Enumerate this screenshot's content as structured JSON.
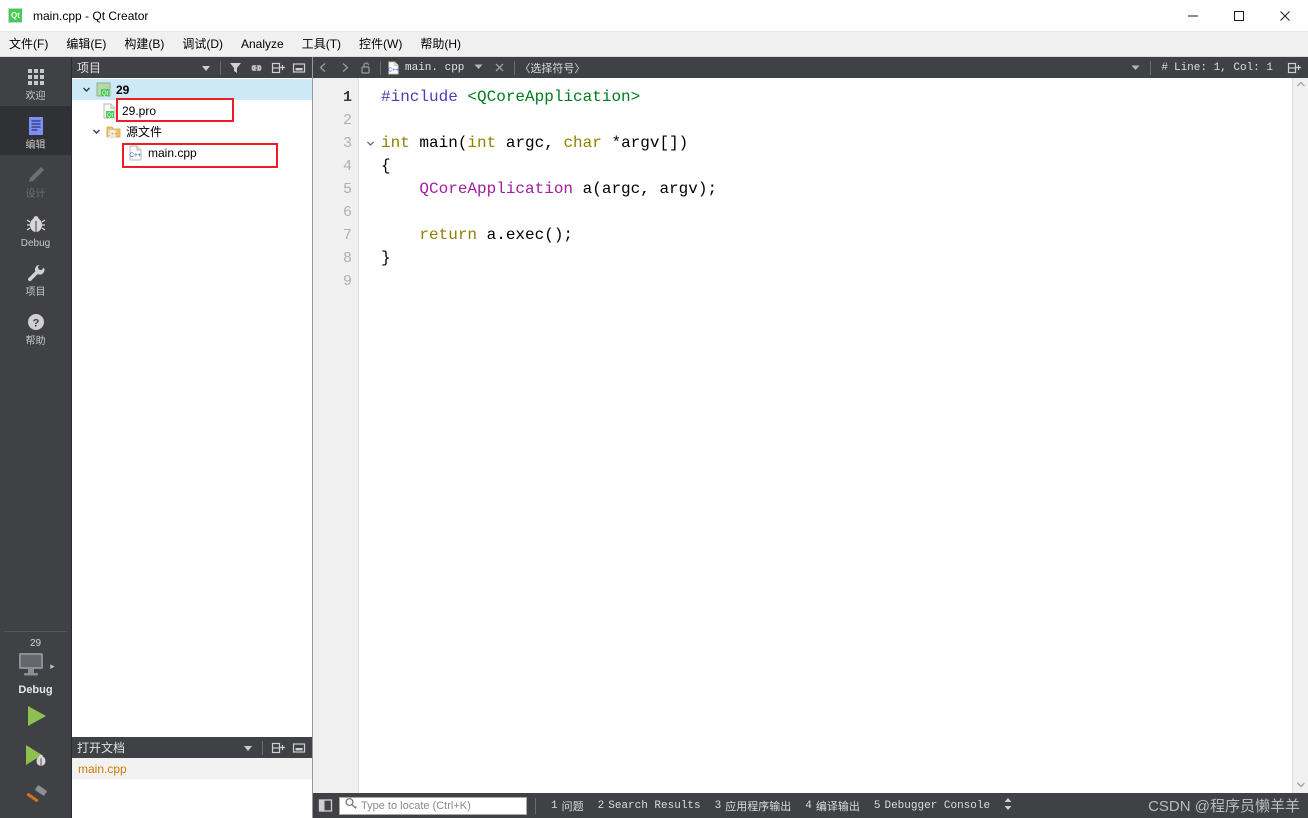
{
  "window": {
    "title": "main.cpp - Qt Creator",
    "app_icon": "qt-logo-icon",
    "logo_text": "Qt",
    "minimize_label": "—",
    "maximize_label": "□",
    "close_label": "✕"
  },
  "menubar": {
    "items": [
      {
        "label": "文件(F)"
      },
      {
        "label": "编辑(E)"
      },
      {
        "label": "构建(B)"
      },
      {
        "label": "调试(D)"
      },
      {
        "label": "Analyze"
      },
      {
        "label": "工具(T)"
      },
      {
        "label": "控件(W)"
      },
      {
        "label": "帮助(H)"
      }
    ]
  },
  "modebar": {
    "items": [
      {
        "label": "欢迎",
        "icon": "grid-icon",
        "state": "normal"
      },
      {
        "label": "编辑",
        "icon": "document-lines-icon",
        "state": "active"
      },
      {
        "label": "设计",
        "icon": "pencil-icon",
        "state": "disabled"
      },
      {
        "label": "Debug",
        "icon": "bug-icon",
        "state": "normal"
      },
      {
        "label": "项目",
        "icon": "wrench-icon",
        "state": "normal"
      },
      {
        "label": "帮助",
        "icon": "question-circle-icon",
        "state": "normal"
      }
    ],
    "kit": {
      "project_name": "29",
      "build_config": "Debug",
      "selector_icon": "monitor-icon",
      "expand_arrow": "▸"
    },
    "actions": [
      {
        "name": "run",
        "icon": "play-triangle-icon"
      },
      {
        "name": "debug",
        "icon": "play-bug-icon"
      },
      {
        "name": "build",
        "icon": "hammer-icon"
      }
    ]
  },
  "project_panel": {
    "title": "项目",
    "tools": [
      {
        "name": "dropdown",
        "icon": "chevron-down-icon"
      },
      {
        "name": "filter",
        "icon": "filter-icon"
      },
      {
        "name": "sync",
        "icon": "link-icon"
      },
      {
        "name": "split",
        "icon": "split-add-icon"
      },
      {
        "name": "close",
        "icon": "close-pane-icon"
      }
    ],
    "tree": [
      {
        "label": "29",
        "icon": "qt-project-icon",
        "depth": 0,
        "expander": "v",
        "selected": true,
        "bold": true,
        "highlight": false
      },
      {
        "label": "29.pro",
        "icon": "qt-pro-file-icon",
        "depth": 1,
        "expander": "",
        "selected": false,
        "bold": false,
        "highlight": true
      },
      {
        "label": "源文件",
        "icon": "cpp-folder-icon",
        "depth": 1,
        "expander": "v",
        "selected": false,
        "bold": false,
        "highlight": false
      },
      {
        "label": "main.cpp",
        "icon": "cpp-file-icon",
        "depth": 2,
        "expander": "",
        "selected": false,
        "bold": false,
        "highlight": true
      }
    ]
  },
  "open_documents": {
    "title": "打开文档",
    "tools": [
      {
        "name": "dropdown",
        "icon": "chevron-down-icon"
      },
      {
        "name": "split",
        "icon": "split-add-icon"
      },
      {
        "name": "close",
        "icon": "close-pane-icon"
      }
    ],
    "documents": [
      {
        "label": "main.cpp"
      }
    ]
  },
  "editor_toolbar": {
    "back_icon": "chevron-left-icon",
    "forward_icon": "chevron-right-icon",
    "lock_icon": "unlock-icon",
    "file_icon": "cpp-file-icon",
    "filename": "main. cpp",
    "file_dropdown_icon": "chevron-down-icon",
    "close_icon": "close-icon",
    "symbol_placeholder": "〈选择符号〉",
    "symbol_dropdown_icon": "chevron-down-icon",
    "hash_icon": "#",
    "cursor_position": "Line: 1, Col: 1",
    "split_icon": "split-add-icon"
  },
  "editor": {
    "lines": [
      {
        "number": "1",
        "current": true,
        "fold": "",
        "tokens": [
          {
            "text": "#include ",
            "cls": "tk-pre"
          },
          {
            "text": "<QCoreApplication>",
            "cls": "tk-inc"
          }
        ]
      },
      {
        "number": "2",
        "current": false,
        "fold": "",
        "tokens": []
      },
      {
        "number": "3",
        "current": false,
        "fold": "v",
        "tokens": [
          {
            "text": "int",
            "cls": "tk-kw"
          },
          {
            "text": " main(",
            "cls": "tk-pl"
          },
          {
            "text": "int",
            "cls": "tk-kw"
          },
          {
            "text": " argc, ",
            "cls": "tk-pl"
          },
          {
            "text": "char",
            "cls": "tk-kw"
          },
          {
            "text": " *argv[])",
            "cls": "tk-pl"
          }
        ]
      },
      {
        "number": "4",
        "current": false,
        "fold": "",
        "tokens": [
          {
            "text": "{",
            "cls": "tk-pl"
          }
        ]
      },
      {
        "number": "5",
        "current": false,
        "fold": "",
        "tokens": [
          {
            "text": "    ",
            "cls": "tk-pl"
          },
          {
            "text": "QCoreApplication",
            "cls": "tk-type"
          },
          {
            "text": " a(argc, argv);",
            "cls": "tk-pl"
          }
        ]
      },
      {
        "number": "6",
        "current": false,
        "fold": "",
        "tokens": []
      },
      {
        "number": "7",
        "current": false,
        "fold": "",
        "tokens": [
          {
            "text": "    ",
            "cls": "tk-pl"
          },
          {
            "text": "return",
            "cls": "tk-kw"
          },
          {
            "text": " a.exec();",
            "cls": "tk-pl"
          }
        ]
      },
      {
        "number": "8",
        "current": false,
        "fold": "",
        "tokens": [
          {
            "text": "}",
            "cls": "tk-pl"
          }
        ]
      },
      {
        "number": "9",
        "current": false,
        "fold": "",
        "tokens": []
      }
    ],
    "scroll_up_icon": "chevron-up-icon",
    "scroll_down_icon": "chevron-down-icon"
  },
  "statusbar": {
    "sidebar_toggle_icon": "sidebar-toggle-icon",
    "locator": {
      "icon": "search-icon",
      "placeholder": "Type to locate (Ctrl+K)",
      "value": ""
    },
    "panes": [
      {
        "num": "1",
        "label": "问题"
      },
      {
        "num": "2",
        "label": "Search Results"
      },
      {
        "num": "3",
        "label": "应用程序输出"
      },
      {
        "num": "4",
        "label": "编译输出"
      },
      {
        "num": "5",
        "label": "Debugger Console"
      }
    ],
    "updown_icon": "↕",
    "watermark": "CSDN @程序员懒羊羊"
  },
  "colors": {
    "dark_chrome": "#3f4145",
    "mode_active": "#2f3134",
    "selection_blue": "#cde8f7",
    "annotation_red": "#ee1c25",
    "qt_green": "#41cd52",
    "run_green": "#8cc152",
    "doc_orange": "#d07b00"
  }
}
